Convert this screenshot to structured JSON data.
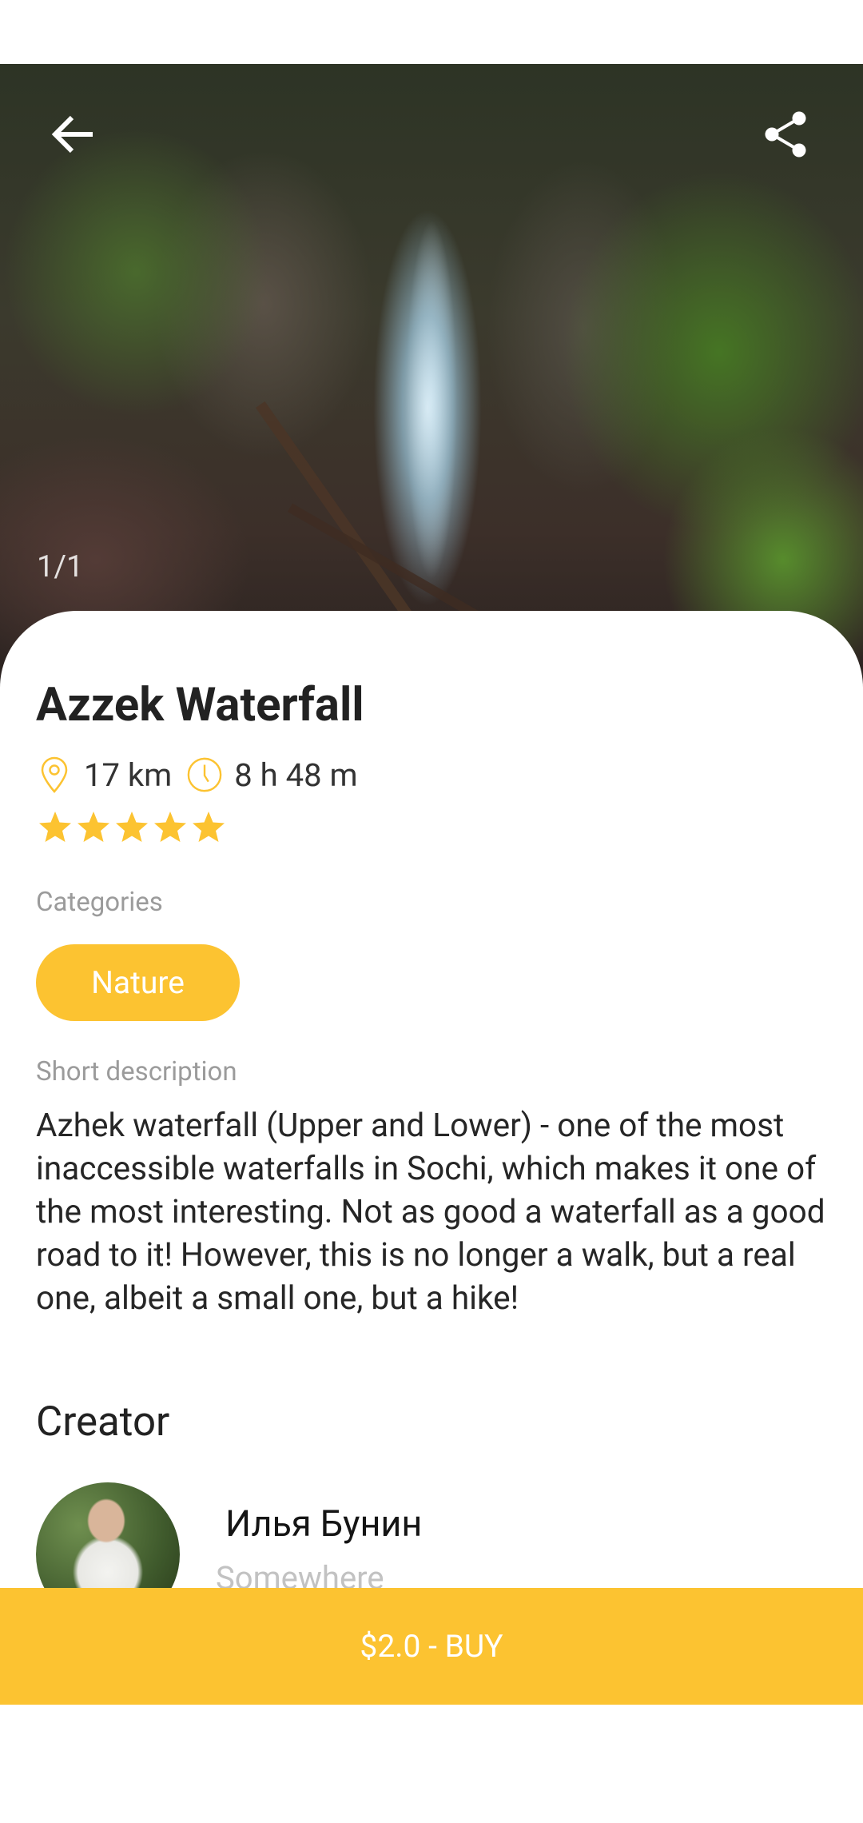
{
  "hero": {
    "counter": "1/1",
    "back_icon": "arrow-left-icon",
    "share_icon": "share-icon"
  },
  "place": {
    "title": "Azzek Waterfall",
    "distance": "17 km",
    "duration": "8 h 48 m",
    "rating": 5,
    "rating_max": 5
  },
  "categories": {
    "label": "Categories",
    "items": [
      "Nature"
    ]
  },
  "description": {
    "label": "Short description",
    "text": "Azhek waterfall (Upper and Lower) - one of the most inaccessible waterfalls in Sochi, which makes it one of the most interesting. Not as good a waterfall as a good road to it! However, this is no longer a walk, but a real one, albeit a small one, but a hike!"
  },
  "creator": {
    "heading": "Creator",
    "name": "Илья Бунин",
    "location": "Somewhere"
  },
  "buy": {
    "label": "$2.0 - BUY"
  },
  "colors": {
    "accent": "#fcc331",
    "title": "#222222",
    "muted": "#9b9b9b"
  }
}
